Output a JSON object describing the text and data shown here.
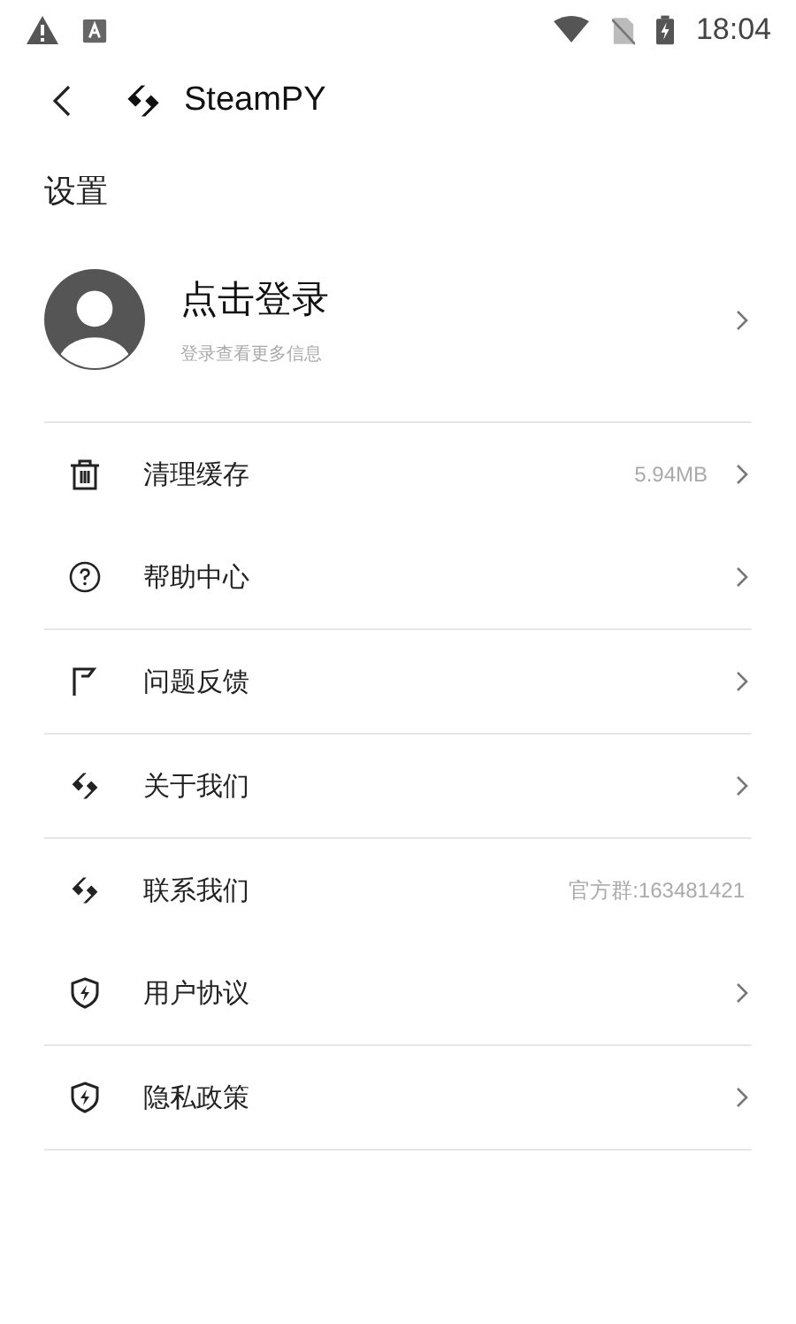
{
  "status_bar": {
    "time": "18:04"
  },
  "app_bar": {
    "title": "SteamPY"
  },
  "section_title": "设置",
  "profile": {
    "name": "点击登录",
    "hint": "登录查看更多信息"
  },
  "items": [
    {
      "kind": "trash",
      "label": "清理缓存",
      "value": "5.94MB",
      "chevron": true,
      "divider": false
    },
    {
      "kind": "help",
      "label": "帮助中心",
      "chevron": true,
      "divider": true
    },
    {
      "kind": "flag",
      "label": "问题反馈",
      "chevron": true,
      "divider": true
    },
    {
      "kind": "logo",
      "label": "关于我们",
      "chevron": true,
      "divider": true
    },
    {
      "kind": "logo",
      "label": "联系我们",
      "value": "官方群:163481421",
      "chevron": false,
      "divider": false
    },
    {
      "kind": "shield",
      "label": "用户协议",
      "chevron": true,
      "divider": true
    },
    {
      "kind": "shield",
      "label": "隐私政策",
      "chevron": true,
      "divider": true
    }
  ]
}
